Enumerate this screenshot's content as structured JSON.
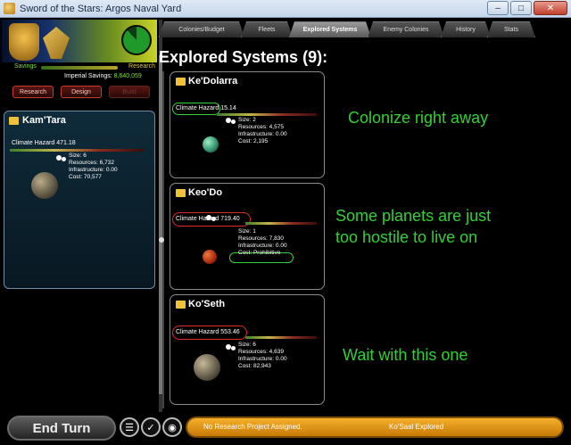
{
  "window": {
    "title": "Sword of the Stars: Argos Naval Yard",
    "min": "–",
    "max": "□",
    "close": "✕"
  },
  "sidebar": {
    "savings_label": "Savings",
    "research_label": "Research",
    "imperial_label": "Imperial Savings:",
    "imperial_value": "8,640,059",
    "buttons": {
      "research": "Research",
      "design": "Design",
      "build": "Build"
    },
    "system": {
      "name": "Kam'Tara",
      "hazard_label": "Climate Hazard",
      "hazard_value": "471.18",
      "size": "Size: 6",
      "resources": "Resources: 6,732",
      "infrastructure": "Infrastructure: 0.00",
      "cost": "Cost: 70,577"
    }
  },
  "tabs": [
    {
      "label": "Colonies/Budget",
      "active": false
    },
    {
      "label": "Fleets",
      "active": false
    },
    {
      "label": "Explored Systems",
      "active": true
    },
    {
      "label": "Enemy Colonies",
      "active": false
    },
    {
      "label": "History",
      "active": false
    },
    {
      "label": "Stats",
      "active": false
    }
  ],
  "page_title": "Explored Systems (9):",
  "systems": [
    {
      "name": "Ke'Dolarra",
      "hazard_label": "Climate Hazard",
      "hazard_value": "15.14",
      "size": "Size: 2",
      "resources": "Resources: 4,575",
      "infrastructure": "Infrastructure: 0.00",
      "cost": "Cost: 2,195",
      "annotation": [
        "Colonize right away"
      ]
    },
    {
      "name": "Keo'Do",
      "hazard_label": "Climate Hazard",
      "hazard_value": "719.40",
      "size": "Size: 1",
      "resources": "Resources: 7,830",
      "infrastructure": "Infrastructure: 0.00",
      "cost": "Cost: Prohibitive",
      "annotation": [
        "Some planets are just",
        "too hostile to live on"
      ]
    },
    {
      "name": "Ko'Seth",
      "hazard_label": "Climate Hazard",
      "hazard_value": "553.46",
      "size": "Size: 6",
      "resources": "Resources: 4,639",
      "infrastructure": "Infrastructure: 0.00",
      "cost": "Cost: 82,943",
      "annotation": [
        "Wait with this one"
      ]
    }
  ],
  "bottom": {
    "end_turn": "End Turn",
    "status_research": "No Research Project Assigned.",
    "status_event": "Ko'Saal Explored"
  },
  "colors": {
    "annotation": "#32d032",
    "ring_good": "#35d23a",
    "ring_bad": "#e02a2a",
    "status_bar": "#f6b02a"
  },
  "icons": [
    "app-icon",
    "crest-icon",
    "economy-pie",
    "folder-icon",
    "chat-icon",
    "check-icon",
    "target-icon"
  ]
}
